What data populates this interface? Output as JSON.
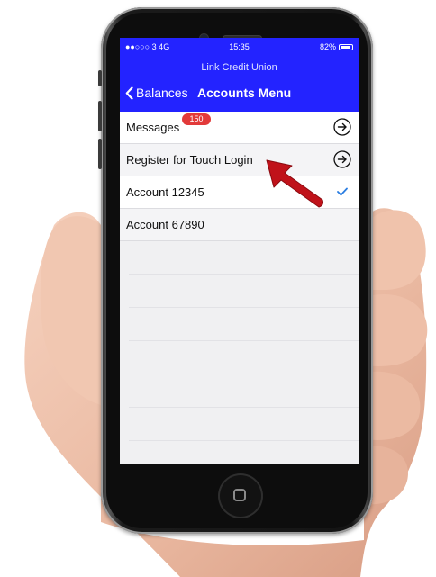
{
  "status_bar": {
    "carrier": "●●○○○ 3  4G",
    "time": "15:35",
    "battery": "82%",
    "battery_level": 0.82
  },
  "nav": {
    "app_title": "Link Credit Union",
    "back_label": "Balances",
    "title": "Accounts Menu",
    "color": "#2323ff"
  },
  "menu": {
    "messages": {
      "label": "Messages",
      "badge": "150"
    },
    "touch_login": {
      "label": "Register for Touch Login"
    },
    "accounts": [
      {
        "label": "Account 12345",
        "selected": true
      },
      {
        "label": "Account 67890",
        "selected": false
      }
    ]
  },
  "colors": {
    "badge": "#e23a3a",
    "check": "#2a7de1",
    "pointer_arrow": "#c0121a"
  },
  "icons": {
    "back": "chevron-left-icon",
    "row_action": "circle-arrow-right-icon",
    "selected": "checkmark-icon",
    "annotation": "red-pointer-arrow"
  }
}
